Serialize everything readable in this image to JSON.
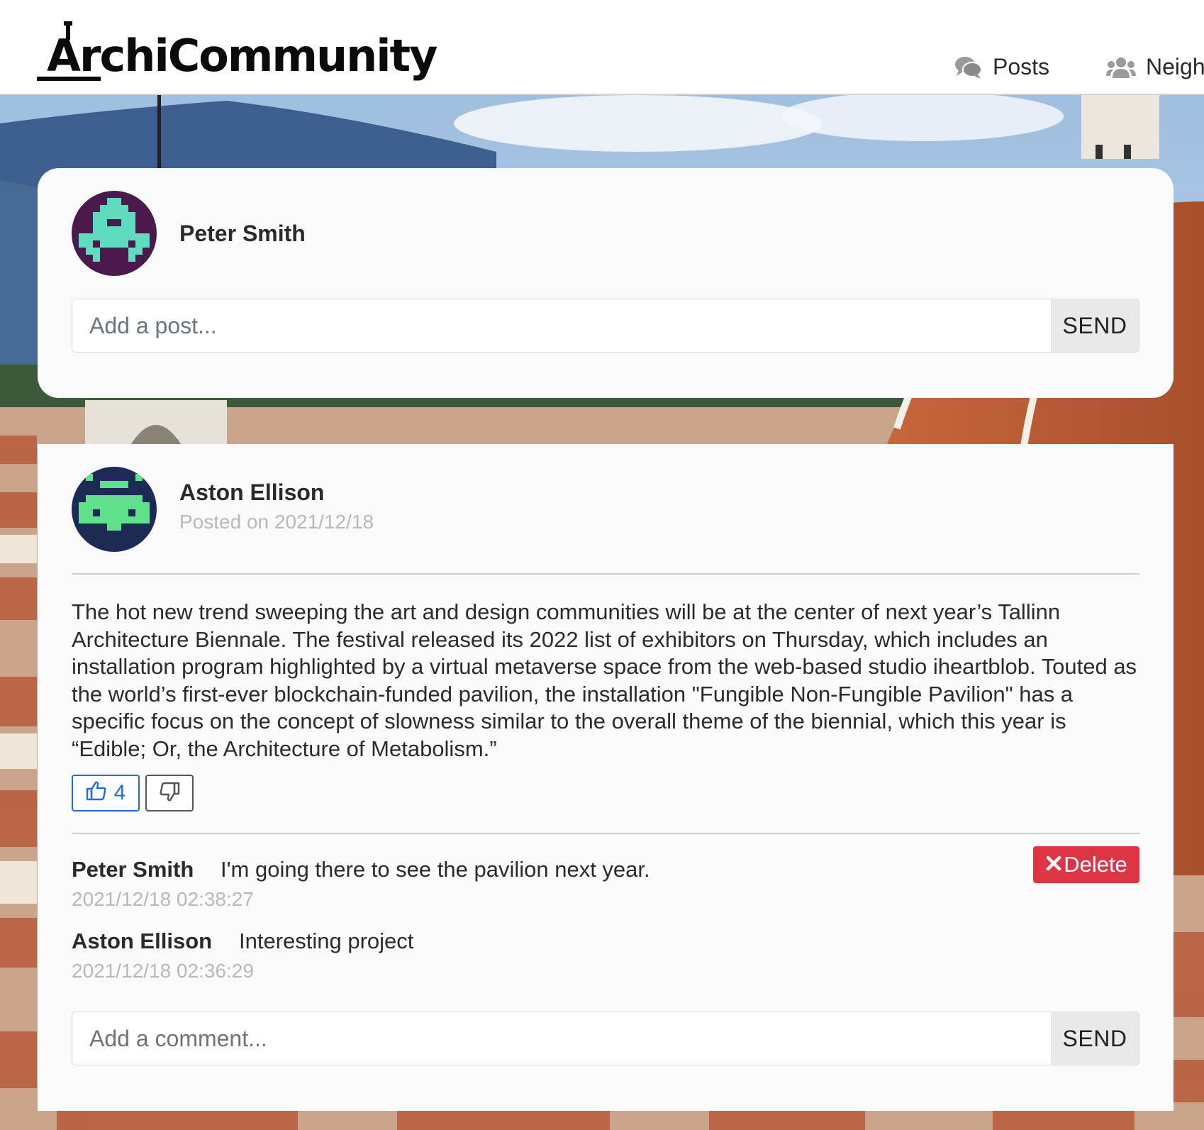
{
  "app": {
    "logo_text": "ArchiCommunity"
  },
  "nav": {
    "items": [
      {
        "label": "Posts",
        "icon": "comments-icon"
      },
      {
        "label": "Neigh",
        "icon": "users-icon"
      }
    ]
  },
  "composer": {
    "user_name": "Peter Smith",
    "placeholder": "Add a post...",
    "send_label": "SEND",
    "avatar_colors": {
      "background": "#4a1a4d",
      "pixels": "#5fdcc0"
    }
  },
  "post": {
    "author": "Aston Ellison",
    "date": "Posted on 2021/12/18",
    "body": "The hot new trend sweeping the art and design communities will be at the center of next year’s Tallinn Architecture Biennale. The festival released its 2022 list of exhibitors on Thursday, which includes an installation program highlighted by a virtual metaverse space from the web-based studio iheartblob. Touted as the world’s first-ever blockchain-funded pavilion, the installation \"Fungible Non-Fungible Pavilion\" has a specific focus on the concept of slowness similar to the overall theme of the biennial, which this year is “Edible; Or, the Architecture of Metabolism.”",
    "likes": "4",
    "avatar_colors": {
      "background": "#1d2a55",
      "pixels": "#5fe08a"
    },
    "comments": [
      {
        "author": "Peter Smith",
        "text": "I'm going there to see the pavilion next year.",
        "time": "2021/12/18 02:38:27",
        "can_delete": true
      },
      {
        "author": "Aston Ellison",
        "text": "Interesting project",
        "time": "2021/12/18 02:36:29",
        "can_delete": false
      }
    ],
    "delete_label": "Delete",
    "comment_placeholder": "Add a comment...",
    "comment_send_label": "SEND"
  },
  "colors": {
    "like_accent": "#1d6ee6",
    "delete_red": "#dc3545"
  }
}
